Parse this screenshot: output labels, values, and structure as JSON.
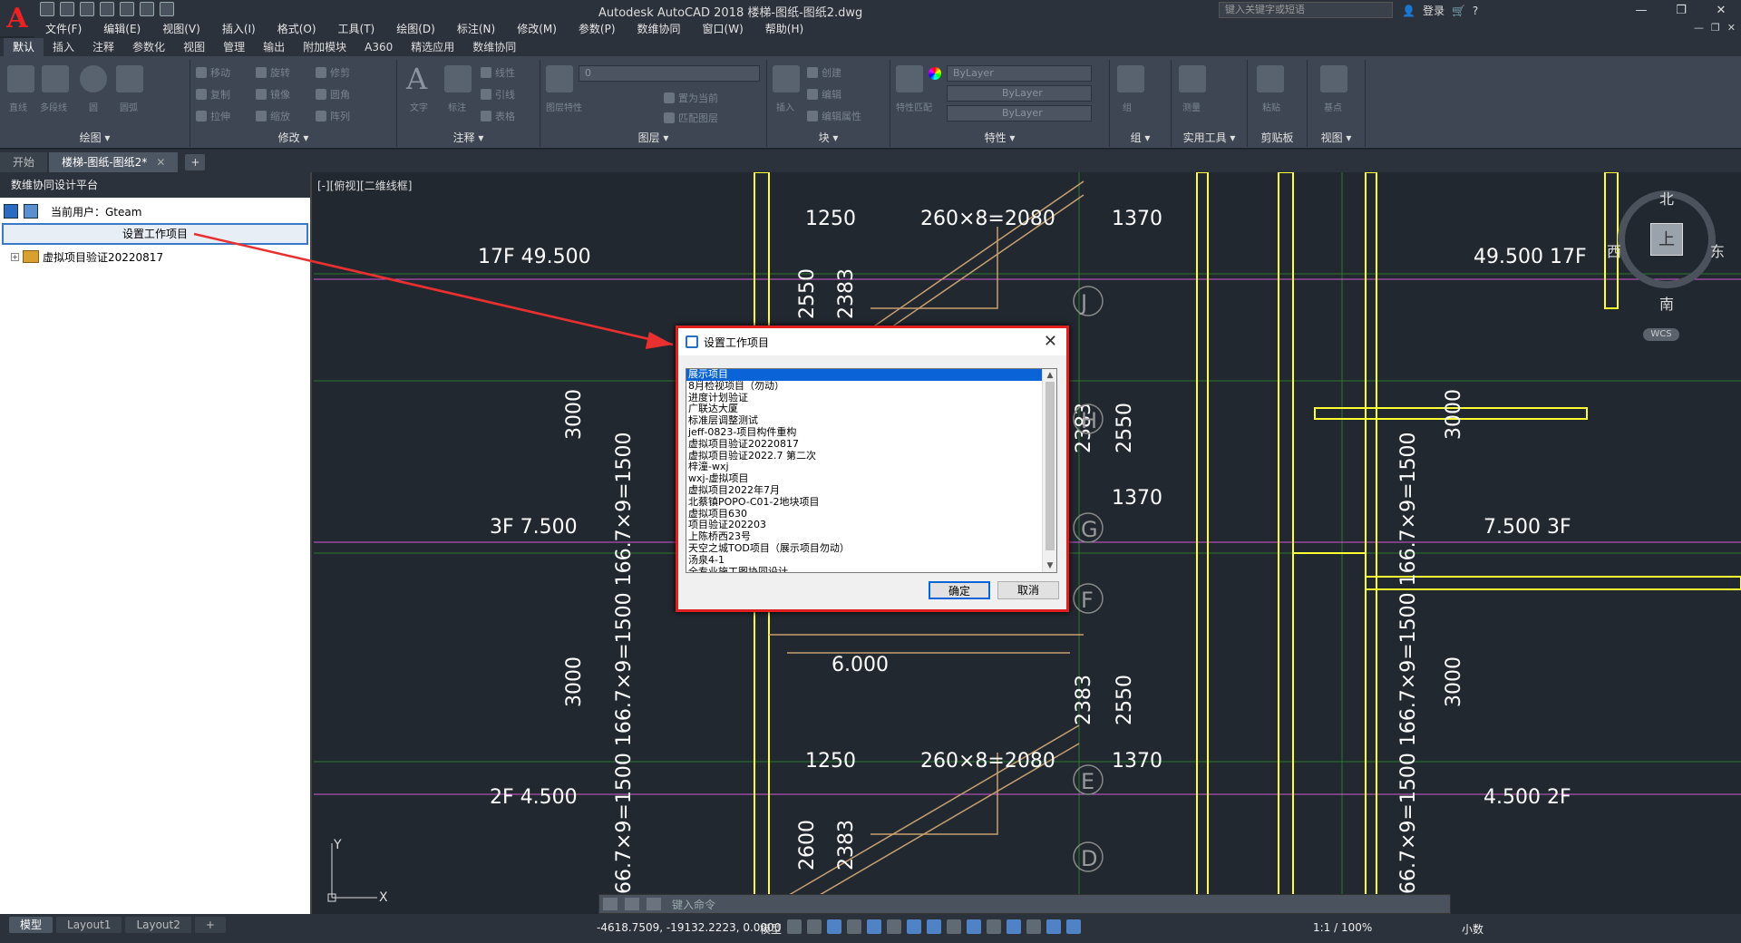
{
  "app": {
    "title": "Autodesk AutoCAD 2018    楼梯-图纸-图纸2.dwg",
    "logo": "A"
  },
  "search": {
    "placeholder": "键入关键字或短语"
  },
  "login": {
    "label": "登录"
  },
  "menu": [
    "文件(F)",
    "编辑(E)",
    "视图(V)",
    "插入(I)",
    "格式(O)",
    "工具(T)",
    "绘图(D)",
    "标注(N)",
    "修改(M)",
    "参数(P)",
    "数维协同",
    "窗口(W)",
    "帮助(H)"
  ],
  "ribbon_tabs": [
    "默认",
    "插入",
    "注释",
    "参数化",
    "视图",
    "管理",
    "输出",
    "附加模块",
    "A360",
    "精选应用",
    "数维协同"
  ],
  "ribbon_panels": {
    "draw": "绘图 ▾",
    "modify": "修改 ▾",
    "annotate": "注释 ▾",
    "layer": "图层 ▾",
    "block": "块 ▾",
    "props": "特性 ▾",
    "group": "组 ▾",
    "utilities": "实用工具 ▾",
    "clipboard": "剪贴板",
    "view": "视图 ▾"
  },
  "ribbon_buttons": {
    "line": "直线",
    "polyline": "多段线",
    "circle": "圆",
    "arc": "圆弧",
    "move": "移动",
    "rotate": "旋转",
    "trim": "修剪",
    "copy": "复制",
    "mirror": "镜像",
    "fillet": "圆角",
    "stretch": "拉伸",
    "scale": "缩放",
    "array": "阵列",
    "text": "文字",
    "dimension": "标注",
    "linear": "线性",
    "leader": "引线",
    "table": "表格",
    "layer_props": "图层特性",
    "insert": "插入",
    "create": "创建",
    "edit": "编辑",
    "edit_attr": "编辑属性",
    "match_props": "特性匹配",
    "group": "组",
    "measure": "测量",
    "paste": "粘贴",
    "base": "基点",
    "set_current": "置为当前",
    "match_layer": "匹配图层",
    "layer_value": "0",
    "bylayer1": "ByLayer",
    "bylayer2": "ByLayer",
    "bylayer3": "ByLayer"
  },
  "doc_tabs": {
    "start": "开始",
    "current": "楼梯-图纸-图纸2*"
  },
  "palette": {
    "header": "数维协同设计平台",
    "current_user": "当前用户：Gteam",
    "set_project_button": "设置工作项目",
    "tree_item": "虚拟项目验证20220817"
  },
  "viewport": {
    "label": "[-][俯视][二维线框]"
  },
  "compass": {
    "north": "北",
    "south": "南",
    "east": "东",
    "west": "西",
    "top": "上",
    "wcs": "WCS"
  },
  "drawing_labels": {
    "l17f": "17F 49.500",
    "l3f": "3F 7.500",
    "l2f": "2F 4.500",
    "r17f": "49.500 17F",
    "r3f": "7.500 3F",
    "r2f": "4.500 2F",
    "d1250a": "1250",
    "d2080a": "260×8=2080",
    "d1370a": "1370",
    "d1370b": "1370",
    "d1250b": "1250",
    "d2080b": "260×8=2080",
    "d1370c": "1370",
    "d2550a": "2550",
    "d2383a": "2383",
    "d2383b": "2383",
    "d2550b": "2550",
    "d2383c": "2383",
    "d2550c": "2550",
    "d2600": "2600",
    "d2383d": "2383",
    "d3000a": "3000",
    "d3000b": "3000",
    "d3000c": "3000",
    "d3000d": "3000",
    "elev": "6.000",
    "vertdim": "166.7×9=1500 166.7×9=1500 166.7×9=1500",
    "gJ": "J",
    "gH": "H",
    "gG": "G",
    "gF": "F",
    "gE": "E",
    "gD": "D",
    "axisY": "Y",
    "axisX": "X"
  },
  "dialog": {
    "title": "设置工作项目",
    "items": [
      "展示项目",
      "8月检视项目（勿动）",
      "进度计划验证",
      "广联达大厦",
      "标准层调整测试",
      "jeff-0823-项目构件重构",
      "虚拟项目验证20220817",
      "虚拟项目验证2022.7 第二次",
      "梓潼-wxj",
      "wxj-虚拟项目",
      "虚拟项目2022年7月",
      "北蔡镇POPO-C01-2地块项目",
      "虚拟项目630",
      "项目验证202203",
      "上陈桥西23号",
      "天空之城TOD项目（展示项目勿动）",
      "汤泉4-1",
      "全专业施工图协同设计"
    ],
    "selected_index": 0,
    "ok": "确定",
    "cancel": "取消"
  },
  "command_line": {
    "placeholder": "键入命令"
  },
  "layout_tabs": [
    "模型",
    "Layout1",
    "Layout2"
  ],
  "status": {
    "coords": "-4618.7509, -19132.2223, 0.0000",
    "model": "模型",
    "scale": "1:1 / 100%",
    "units": "小数"
  },
  "colors": {
    "accent_red": "#e02020",
    "selection_blue": "#0a64d8",
    "grid_green": "#1fd21f",
    "wall_yellow": "#ffff33",
    "stair_brown": "#c8a070"
  }
}
